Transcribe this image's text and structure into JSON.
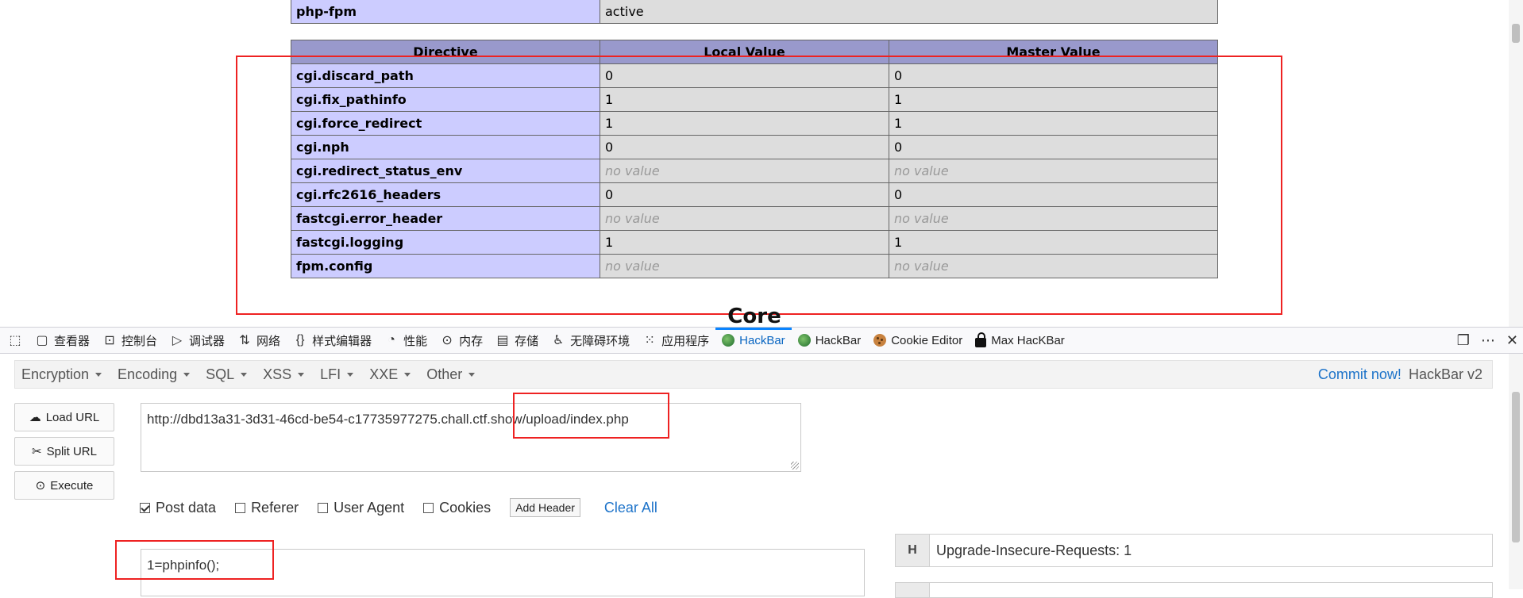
{
  "phpinfo": {
    "top_row": {
      "directive": "php-fpm",
      "value": "active"
    },
    "headers": [
      "Directive",
      "Local Value",
      "Master Value"
    ],
    "rows": [
      {
        "directive": "cgi.discard_path",
        "local": "0",
        "master": "0",
        "no_value": false
      },
      {
        "directive": "cgi.fix_pathinfo",
        "local": "1",
        "master": "1",
        "no_value": false
      },
      {
        "directive": "cgi.force_redirect",
        "local": "1",
        "master": "1",
        "no_value": false
      },
      {
        "directive": "cgi.nph",
        "local": "0",
        "master": "0",
        "no_value": false
      },
      {
        "directive": "cgi.redirect_status_env",
        "local": "no value",
        "master": "no value",
        "no_value": true
      },
      {
        "directive": "cgi.rfc2616_headers",
        "local": "0",
        "master": "0",
        "no_value": false
      },
      {
        "directive": "fastcgi.error_header",
        "local": "no value",
        "master": "no value",
        "no_value": true
      },
      {
        "directive": "fastcgi.logging",
        "local": "1",
        "master": "1",
        "no_value": false
      },
      {
        "directive": "fpm.config",
        "local": "no value",
        "master": "no value",
        "no_value": true
      }
    ],
    "section_heading": "Core"
  },
  "devtools": {
    "tabs": [
      {
        "label": "查看器",
        "icon": "inspector-icon"
      },
      {
        "label": "控制台",
        "icon": "console-icon"
      },
      {
        "label": "调试器",
        "icon": "debugger-icon"
      },
      {
        "label": "网络",
        "icon": "network-icon"
      },
      {
        "label": "样式编辑器",
        "icon": "style-editor-icon"
      },
      {
        "label": "性能",
        "icon": "performance-icon"
      },
      {
        "label": "内存",
        "icon": "memory-icon"
      },
      {
        "label": "存储",
        "icon": "storage-icon"
      },
      {
        "label": "无障碍环境",
        "icon": "accessibility-icon"
      },
      {
        "label": "应用程序",
        "icon": "application-icon"
      },
      {
        "label": "HackBar",
        "icon": "hackbar-icon",
        "active": true
      },
      {
        "label": "HackBar",
        "icon": "hackbar-icon"
      },
      {
        "label": "Cookie Editor",
        "icon": "cookie-icon"
      },
      {
        "label": "Max HacKBar",
        "icon": "lock-icon"
      }
    ]
  },
  "hackbar": {
    "menus": [
      "Encryption",
      "Encoding",
      "SQL",
      "XSS",
      "LFI",
      "XXE",
      "Other"
    ],
    "commit_link": "Commit now!",
    "version": "HackBar v2",
    "buttons": {
      "load": "Load URL",
      "split": "Split URL",
      "execute": "Execute"
    },
    "url": "http://dbd13a31-3d31-46cd-be54-c17735977275.chall.ctf.show/upload/index.php",
    "checkboxes": [
      {
        "label": "Post data",
        "checked": true
      },
      {
        "label": "Referer",
        "checked": false
      },
      {
        "label": "User Agent",
        "checked": false
      },
      {
        "label": "Cookies",
        "checked": false
      }
    ],
    "add_header": "Add Header",
    "clear_all": "Clear All",
    "post_body": "1=phpinfo();",
    "header_key": "H",
    "header_value": "Upgrade-Insecure-Requests: 1"
  },
  "colors": {
    "annotation": "#e22222",
    "link": "#1d73c9",
    "active_tab": "#0a84ff"
  }
}
